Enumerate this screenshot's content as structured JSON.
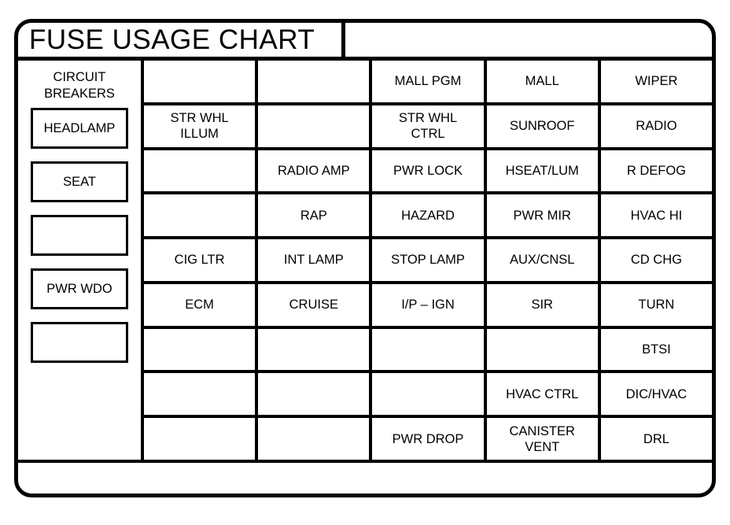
{
  "chart": {
    "title": "FUSE USAGE CHART",
    "breaker_column": {
      "heading_line1": "CIRCUIT",
      "heading_line2": "BREAKERS",
      "boxes": [
        {
          "label": "HEADLAMP"
        },
        {
          "label": "SEAT"
        },
        {
          "label": ""
        },
        {
          "label": "PWR WDO"
        },
        {
          "label": ""
        }
      ]
    },
    "columns": [
      {
        "name": "column-2",
        "cells": [
          "",
          "STR WHL\nILLUM",
          "",
          "",
          "CIG LTR",
          "ECM",
          "",
          "",
          ""
        ]
      },
      {
        "name": "column-3",
        "cells": [
          "",
          "",
          "RADIO AMP",
          "RAP",
          "INT LAMP",
          "CRUISE",
          "",
          "",
          ""
        ]
      },
      {
        "name": "column-4",
        "cells": [
          "MALL PGM",
          "STR WHL\nCTRL",
          "PWR LOCK",
          "HAZARD",
          "STOP LAMP",
          "I/P – IGN",
          "",
          "",
          "PWR DROP"
        ]
      },
      {
        "name": "column-5",
        "cells": [
          "MALL",
          "SUNROOF",
          "HSEAT/LUM",
          "PWR MIR",
          "AUX/CNSL",
          "SIR",
          "",
          "HVAC CTRL",
          "CANISTER\nVENT"
        ]
      },
      {
        "name": "column-6",
        "cells": [
          "WIPER",
          "RADIO",
          "R DEFOG",
          "HVAC HI",
          "CD CHG",
          "TURN",
          "BTSI",
          "DIC/HVAC",
          "DRL"
        ]
      }
    ]
  }
}
